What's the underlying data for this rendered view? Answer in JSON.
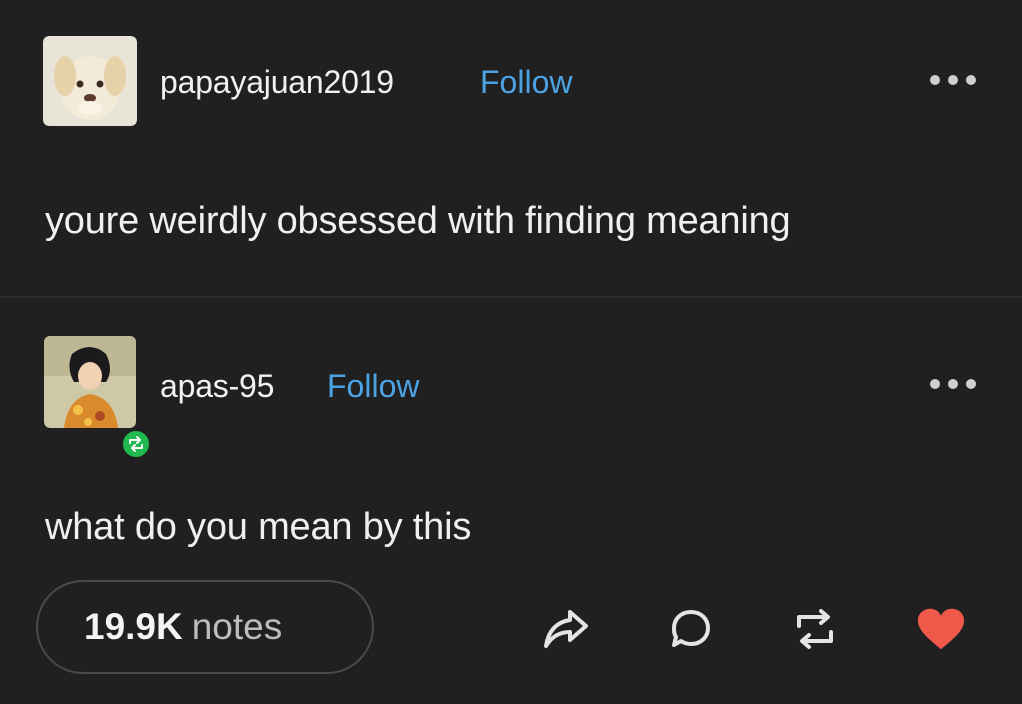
{
  "posts": [
    {
      "username": "papayajuan2019",
      "follow_label": "Follow",
      "avatar_icon": "puppy-plush-avatar",
      "text": "youre weirdly obsessed with finding meaning"
    },
    {
      "username": "apas-95",
      "follow_label": "Follow",
      "avatar_icon": "anime-character-avatar",
      "reblog_badge_icon": "reblog-icon",
      "text": "what do you mean by this"
    }
  ],
  "footer": {
    "notes_count": "19.9K",
    "notes_label": "notes",
    "actions": [
      "share-icon",
      "reply-icon",
      "reblog-icon",
      "like-icon"
    ]
  },
  "colors": {
    "background": "#202020",
    "follow": "#4ba3e3",
    "reblog_badge": "#21b84f",
    "like": "#f0584a"
  }
}
